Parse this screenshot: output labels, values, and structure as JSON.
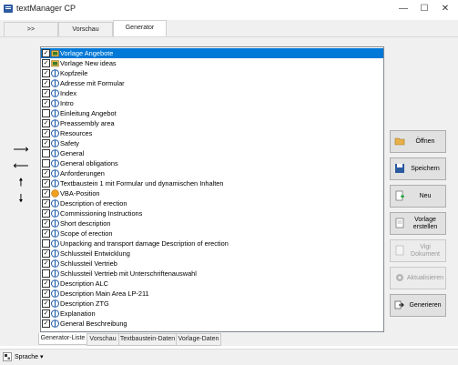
{
  "window": {
    "title": "textManager CP",
    "minimize": "—",
    "maximize": "☐",
    "close": "✕"
  },
  "top_tabs": [
    {
      "label": ">>"
    },
    {
      "label": "Vorschau"
    },
    {
      "label": "Generator"
    }
  ],
  "list": {
    "items": [
      {
        "label": "Vorlage Angebote",
        "checked": true,
        "icon": "folder-template-icon",
        "selected": true
      },
      {
        "label": "Vorlage New ideas",
        "checked": true,
        "icon": "folder-template-icon"
      },
      {
        "label": "Kopfzeile",
        "checked": true,
        "icon": "text-block-icon"
      },
      {
        "label": "Adresse mit Formular",
        "checked": true,
        "icon": "text-block-icon"
      },
      {
        "label": "Index",
        "checked": true,
        "icon": "text-block-icon"
      },
      {
        "label": "Intro",
        "checked": true,
        "icon": "text-block-icon"
      },
      {
        "label": "Einleitung Angebot",
        "checked": false,
        "icon": "text-block-icon"
      },
      {
        "label": "Preassembly area",
        "checked": true,
        "icon": "text-block-icon"
      },
      {
        "label": "Resources",
        "checked": true,
        "icon": "text-block-icon"
      },
      {
        "label": "Safety",
        "checked": true,
        "icon": "text-block-icon"
      },
      {
        "label": "General",
        "checked": false,
        "icon": "text-block-icon"
      },
      {
        "label": "General obligations",
        "checked": false,
        "icon": "text-block-icon"
      },
      {
        "label": "Anforderungen",
        "checked": true,
        "icon": "text-block-icon"
      },
      {
        "label": "Textbaustein 1 mit Formular und dynamischen Inhalten",
        "checked": true,
        "icon": "text-block-icon"
      },
      {
        "label": "VBA-Position",
        "checked": true,
        "icon": "vba-icon"
      },
      {
        "label": "Description of erection",
        "checked": true,
        "icon": "text-block-icon"
      },
      {
        "label": "Commissioning Instructions",
        "checked": true,
        "icon": "text-block-icon"
      },
      {
        "label": "Short description",
        "checked": true,
        "icon": "text-block-icon"
      },
      {
        "label": "Scope of erection",
        "checked": true,
        "icon": "text-block-icon"
      },
      {
        "label": "Unpacking and transport damage Description of erection",
        "checked": false,
        "icon": "text-block-icon"
      },
      {
        "label": "Schlussteil Entwicklung",
        "checked": true,
        "icon": "text-block-icon"
      },
      {
        "label": "Schlussteil Vertrieb",
        "checked": true,
        "icon": "text-block-icon"
      },
      {
        "label": "Schlussteil Vertrieb mit Unterschriftenauswahl",
        "checked": false,
        "icon": "text-block-icon"
      },
      {
        "label": "Description ALC",
        "checked": true,
        "icon": "text-block-icon"
      },
      {
        "label": "Description Main Area LP-211",
        "checked": true,
        "icon": "text-block-icon"
      },
      {
        "label": "Description ZTG",
        "checked": true,
        "icon": "text-block-icon"
      },
      {
        "label": "Explanation",
        "checked": true,
        "icon": "text-block-icon"
      },
      {
        "label": "General Beschreibung",
        "checked": true,
        "icon": "text-block-icon"
      }
    ]
  },
  "buttons": {
    "open": "Öffnen",
    "save": "Speichern",
    "new": "Neu",
    "create_template": "Vorlage erstellen",
    "view_document": "Vigi Dokument",
    "update": "Aktualisieren",
    "generate": "Generieren"
  },
  "bottom_tabs": [
    {
      "label": "Generator-Liste"
    },
    {
      "label": "Vorschau"
    },
    {
      "label": "Textbaustein-Daten"
    },
    {
      "label": "Vorlage-Daten"
    }
  ],
  "status": {
    "language_label": "Sprache",
    "dropdown": "▾"
  },
  "colors": {
    "selection": "#0078d7",
    "accent_icon": "#1e5aa8"
  }
}
